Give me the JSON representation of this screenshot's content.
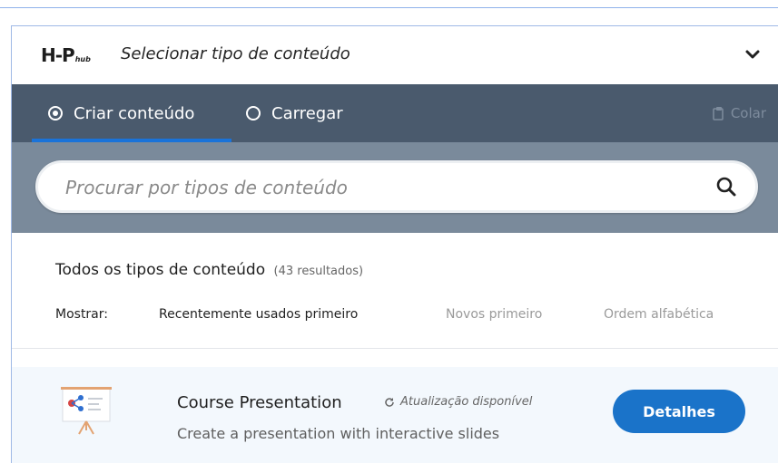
{
  "header": {
    "logo_main": "H-P",
    "logo_sub": "hub",
    "title": "Selecionar tipo de conteúdo"
  },
  "tabs": {
    "create_label": "Criar conteúdo",
    "upload_label": "Carregar",
    "paste_label": "Colar",
    "active": "create"
  },
  "search": {
    "placeholder": "Procurar por tipos de conteúdo",
    "value": ""
  },
  "list": {
    "title": "Todos os tipos de conteúdo",
    "count": "(43 resultados)",
    "sort_label": "Mostrar:",
    "sort_options": [
      {
        "label": "Recentemente usados primeiro",
        "active": true
      },
      {
        "label": "Novos primeiro",
        "active": false
      },
      {
        "label": "Ordem alfabética",
        "active": false
      }
    ]
  },
  "items": [
    {
      "title": "Course Presentation",
      "update_text": "Atualização disponível",
      "description": "Create a presentation with interactive slides",
      "details_label": "Detalhes",
      "icon": "presentation-board-icon"
    }
  ],
  "colors": {
    "tab_bar": "#4a5a6d",
    "search_area": "#7a8a9b",
    "accent": "#1a73c9",
    "item_bg": "#f3f8fd"
  }
}
